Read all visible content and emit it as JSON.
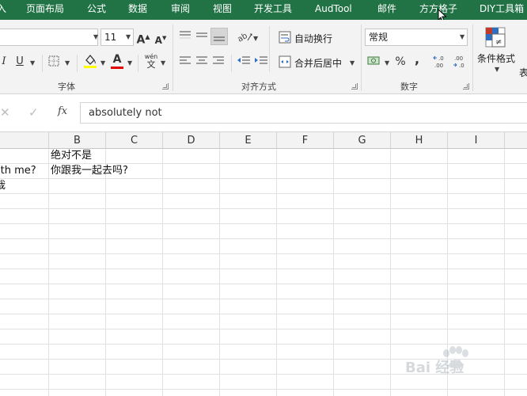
{
  "tabs": [
    "入",
    "页面布局",
    "公式",
    "数据",
    "审阅",
    "视图",
    "开发工具",
    "AudTool",
    "邮件",
    "方方格子",
    "DIY工具箱"
  ],
  "ribbon": {
    "font_size": "11",
    "wrap_text": "自动换行",
    "merge_center": "合并后居中",
    "number_format": "常规",
    "conditional_format": "条件格式",
    "partial_label": "表",
    "groups": {
      "font": "字体",
      "alignment": "对齐方式",
      "number": "数字"
    },
    "italic": "I",
    "underline": "U",
    "wen_icon_top": "wén",
    "wen_icon_bottom": "文",
    "percent": "%",
    "comma": ",",
    "dec_increase": "←.0 .00",
    "dec_decrease": ".00 →.0",
    "font_color_letter": "A"
  },
  "formula_bar": {
    "cancel": "✕",
    "enter": "✓",
    "fx": "fx",
    "value": "absolutely not"
  },
  "columns": [
    "B",
    "C",
    "D",
    "E",
    "F",
    "G",
    "H",
    "I"
  ],
  "cells": {
    "a2": "ith me?",
    "a3": "哉",
    "b1": "绝对不是",
    "b2": "你跟我一起去吗?"
  },
  "watermark": "Bai 经验",
  "colors": {
    "menu_bg": "#217346",
    "ribbon_bg": "#f3f3f3",
    "font_color_bar": "#e00000",
    "highlight_bar": "#ffff00"
  }
}
